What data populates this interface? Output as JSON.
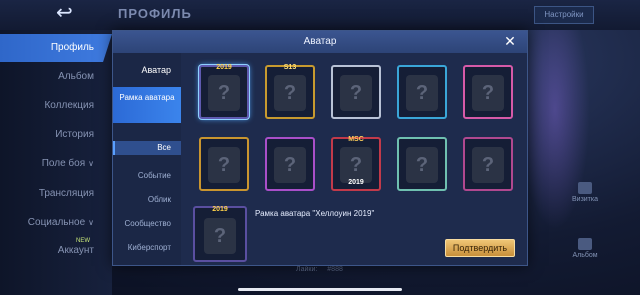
{
  "background": {
    "title": "ПРОФИЛЬ",
    "back_icon": "back-arrow-icon",
    "settings_label": "Настройки",
    "sidebar": [
      {
        "label": "Профиль",
        "active": true,
        "chevron": false
      },
      {
        "label": "Альбом",
        "active": false,
        "chevron": false
      },
      {
        "label": "Коллекция",
        "active": false,
        "chevron": false
      },
      {
        "label": "История",
        "active": false,
        "chevron": false
      },
      {
        "label": "Поле боя",
        "active": false,
        "chevron": true
      },
      {
        "label": "Трансляция",
        "active": false,
        "chevron": false
      },
      {
        "label": "Социальное",
        "active": false,
        "chevron": true
      },
      {
        "label": "Аккаунт",
        "active": false,
        "chevron": false,
        "badge": "NEW"
      }
    ],
    "right_items": [
      {
        "label": "Визитка"
      },
      {
        "label": "Альбом"
      }
    ],
    "bottom_labels": [
      "Лайки:",
      "#888"
    ]
  },
  "modal": {
    "title": "Аватар",
    "close_icon": "close-icon",
    "categories": [
      {
        "label": "Аватар",
        "kind": "main"
      },
      {
        "label": "Рамка аватара",
        "kind": "main-selected"
      },
      {
        "label": "Все",
        "kind": "sub-selected"
      },
      {
        "label": "Событие",
        "kind": "sub"
      },
      {
        "label": "Облик",
        "kind": "sub"
      },
      {
        "label": "Сообщество",
        "kind": "sub"
      },
      {
        "label": "Киберспорт",
        "kind": "sub"
      }
    ],
    "frames": [
      {
        "tag": "2019",
        "tag_pos": "top",
        "color": "#5e5ab0",
        "tag_color": "#ffd24a",
        "selected": true
      },
      {
        "tag": "S13",
        "tag_pos": "top",
        "color": "#c79a2f",
        "tag_color": "#ffe07a",
        "selected": false
      },
      {
        "tag": "",
        "tag_pos": "top",
        "color": "#b8c2d6",
        "tag_color": "#ffffff",
        "selected": false
      },
      {
        "tag": "",
        "tag_pos": "top",
        "color": "#3aa6d8",
        "tag_color": "#ffffff",
        "selected": false
      },
      {
        "tag": "",
        "tag_pos": "top",
        "color": "#d65aa8",
        "tag_color": "#ffffff",
        "selected": false
      },
      {
        "tag": "",
        "tag_pos": "top",
        "color": "#c9952f",
        "tag_color": "#ffffff",
        "selected": false
      },
      {
        "tag": "",
        "tag_pos": "top",
        "color": "#a94fc9",
        "tag_color": "#ffffff",
        "selected": false
      },
      {
        "tag": "MSC",
        "tag_pos": "top",
        "color": "#c23a4a",
        "tag_color": "#ffcf5a",
        "extra": "2019",
        "selected": false
      },
      {
        "tag": "",
        "tag_pos": "top",
        "color": "#6fc0b0",
        "tag_color": "#ffffff",
        "selected": false
      },
      {
        "tag": "",
        "tag_pos": "top",
        "color": "#b0488f",
        "tag_color": "#ffffff",
        "selected": false
      }
    ],
    "placeholder_glyph": "?",
    "detail": {
      "thumb_tag": "2019",
      "name": "Рамка аватара \"Хеллоуин 2019\"",
      "confirm_label": "Подтвердить"
    }
  }
}
